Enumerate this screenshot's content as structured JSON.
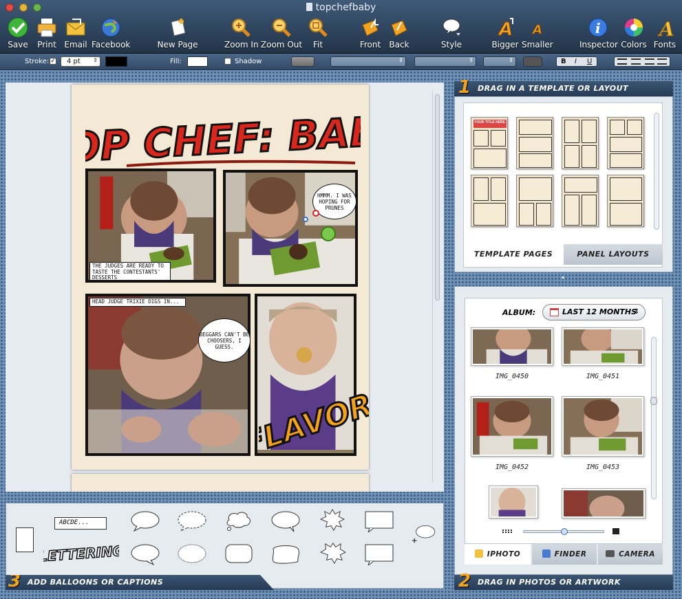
{
  "window": {
    "title": "topchefbaby"
  },
  "toolbar": {
    "save": "Save",
    "print": "Print",
    "email": "Email",
    "facebook": "Facebook",
    "new_page": "New Page",
    "zoom_in": "Zoom In",
    "zoom_out": "Zoom Out",
    "fit": "Fit",
    "front": "Front",
    "back": "Back",
    "style": "Style",
    "bigger": "Bigger",
    "smaller": "Smaller",
    "inspector": "Inspector",
    "colors": "Colors",
    "fonts": "Fonts"
  },
  "format_bar": {
    "stroke_label": "Stroke:",
    "stroke_checked": true,
    "stroke_width": "4 pt",
    "stroke_color": "#000000",
    "fill_label": "Fill:",
    "fill_color": "#ffffff",
    "shadow_label": "Shadow",
    "shadow_checked": false,
    "bold": "B",
    "italic": "I",
    "underline": "U"
  },
  "comic": {
    "title": "TOP CHEF: BABY",
    "caption1": "THE JUDGES ARE READY TO TASTE THE CONTESTANTS' DESSERTS",
    "balloon1": "HMMM. I WAS HOPING FOR PRUNES",
    "caption2": "HEAD JUDGE TRIXIE DIGS IN...",
    "balloon2": "BEGGARS CAN'T BE CHOOSERS, I GUESS.",
    "sfx": "FLAVOR!"
  },
  "templates_panel": {
    "step": "1",
    "header": "Drag in a template or layout",
    "tabs": [
      "Template Pages",
      "Panel Layouts"
    ],
    "active_tab": 0,
    "thumb_title": "YOUR TITLE HERE"
  },
  "photos_panel": {
    "step": "2",
    "header": "Drag in photos or artwork",
    "album_label": "ALBUM:",
    "album_value": "LAST 12 MONTHS",
    "photos": [
      "IMG_0450",
      "IMG_0451",
      "IMG_0452",
      "IMG_0453"
    ],
    "tabs": [
      "iPhoto",
      "Finder",
      "Camera"
    ],
    "active_tab": 0
  },
  "balloons_panel": {
    "step": "3",
    "header": "Add balloons or captions",
    "caption_sample": "ABCDE...",
    "lettering_sample": "LETTERING"
  }
}
